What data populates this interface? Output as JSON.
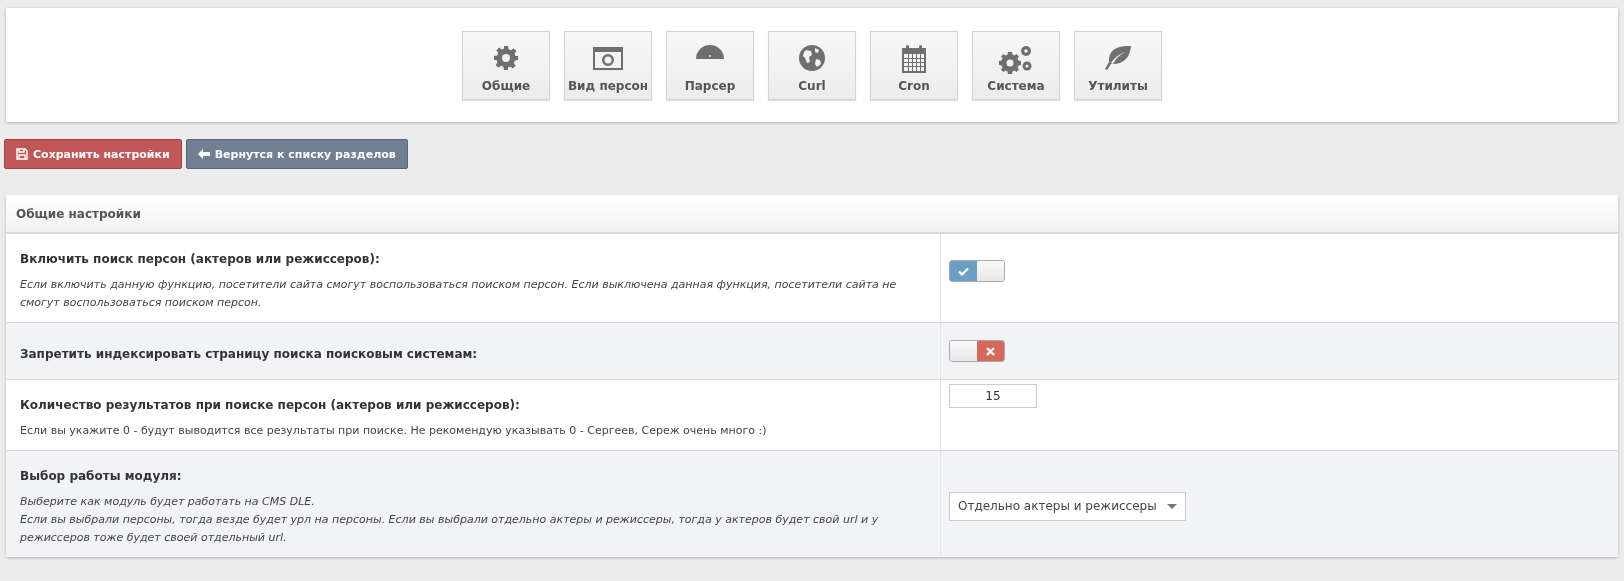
{
  "nav": [
    {
      "label": "Общие"
    },
    {
      "label": "Вид персон"
    },
    {
      "label": "Парсер"
    },
    {
      "label": "Curl"
    },
    {
      "label": "Cron"
    },
    {
      "label": "Система"
    },
    {
      "label": "Утилиты"
    }
  ],
  "actions": [
    {
      "label": "Сохранить настройки",
      "kind": "save"
    },
    {
      "label": "Вернутся к списку разделов",
      "kind": "back"
    }
  ],
  "panel": {
    "title": "Общие настройки",
    "rows": [
      {
        "kind": "toggle",
        "label": "Включить поиск персон (актеров или режиссеров):",
        "description": "Если включить данную функцию, посетители сайта смогут воспользоваться поиском персон. Если выключена данная функция, посетители сайта не смогут воспользоваться поиском персон.",
        "description_italic": true,
        "on": true
      },
      {
        "kind": "toggle",
        "label": "Запретить индексировать страницу поиска поисковым системам:",
        "on": false
      },
      {
        "kind": "number",
        "label": "Количество результатов при поиске персон (актеров или режиссеров):",
        "description": "Если вы укажите 0 - будут выводится все результаты при поиске. Не рекомендую указывать 0 - Сергеев, Сереж очень много :)",
        "description_italic": false,
        "value": "15"
      },
      {
        "kind": "select",
        "label": "Выбор работы модуля:",
        "description_lines": [
          "Выберите как модуль будет работать на CMS DLE.",
          "Если вы выбрали персоны, тогда везде будет урл на персоны. Если вы выбрали отдельно актеры и режиссеры, тогда у актеров будет свой url и у режиссеров тоже будет своей отдельный url."
        ],
        "description_italic": true,
        "value": "Отдельно актеры и режиссеры"
      }
    ]
  }
}
